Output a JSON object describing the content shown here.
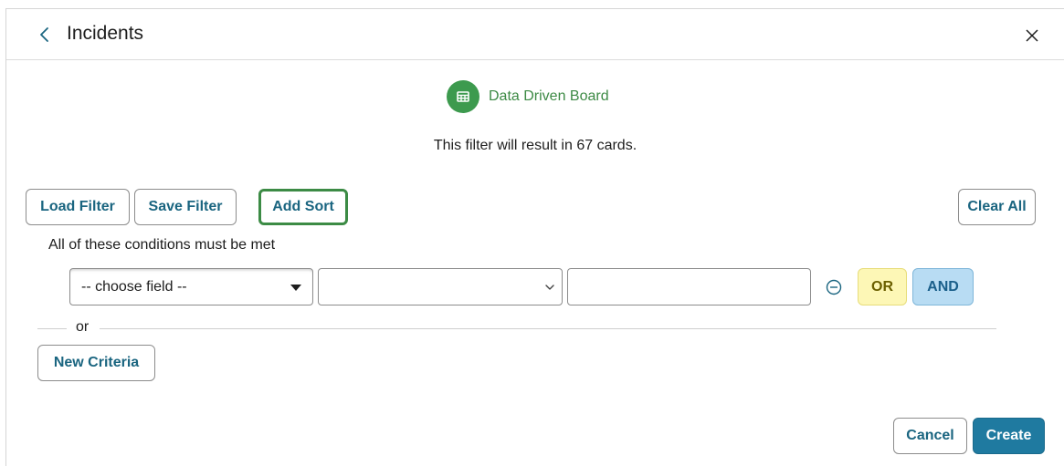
{
  "header": {
    "title": "Incidents",
    "back_icon": "chevron-left-icon",
    "close_icon": "close-icon"
  },
  "board": {
    "icon": "table-grid-icon",
    "label": "Data Driven Board",
    "color": "#3d9a4e"
  },
  "result_text": "This filter will result in 67 cards.",
  "toolbar": {
    "load_label": "Load Filter",
    "save_label": "Save Filter",
    "sort_label": "Add Sort",
    "clear_label": "Clear All"
  },
  "criteria": {
    "conditions_label": "All of these conditions must be met",
    "field_value": "-- choose field --",
    "operator_value": "",
    "value_text": "",
    "or_label": "OR",
    "and_label": "AND"
  },
  "separator_label": "or",
  "new_criteria_label": "New Criteria",
  "footer": {
    "cancel_label": "Cancel",
    "create_label": "Create"
  },
  "colors": {
    "accent": "#1f7aa0",
    "sort_border": "#3c8b45",
    "or_bg": "#fdf7b6",
    "and_bg": "#b8dcf3"
  }
}
